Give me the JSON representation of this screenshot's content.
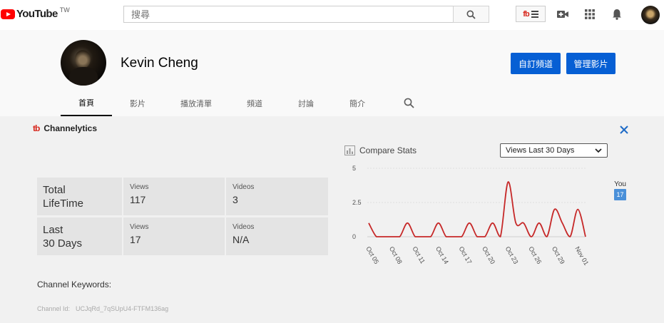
{
  "topbar": {
    "logo_text": "YouTube",
    "logo_region": "TW",
    "search_placeholder": "搜尋",
    "icons": [
      "search-icon",
      "tubebuddy-menu-icon",
      "create-video-icon",
      "apps-grid-icon",
      "notifications-bell-icon",
      "account-avatar"
    ]
  },
  "channel": {
    "name": "Kevin Cheng",
    "customize_button": "自訂頻道",
    "manage_button": "管理影片",
    "tabs": [
      {
        "label": "首頁",
        "active": true
      },
      {
        "label": "影片",
        "active": false
      },
      {
        "label": "播放清單",
        "active": false
      },
      {
        "label": "頻道",
        "active": false
      },
      {
        "label": "討論",
        "active": false
      },
      {
        "label": "簡介",
        "active": false
      }
    ]
  },
  "channelytics": {
    "logo": "tb",
    "title": "Channelytics",
    "stats": {
      "lifetime": {
        "label_line1": "Total",
        "label_line2": "LifeTime",
        "views_label": "Views",
        "views": "117",
        "videos_label": "Videos",
        "videos": "3"
      },
      "last30": {
        "label_line1": "Last",
        "label_line2": "30 Days",
        "views_label": "Views",
        "views": "17",
        "videos_label": "Videos",
        "videos": "N/A"
      }
    },
    "keywords_label": "Channel Keywords:",
    "channel_id_label": "Channel Id:",
    "channel_id": "UCJqRd_7qSUpU4-FTFM136ag",
    "compare_label": "Compare Stats",
    "compare_select": "Views Last 30 Days",
    "legend_label": "You",
    "legend_value": "17"
  },
  "colors": {
    "brand_red": "#ff0000",
    "button_blue": "#065fd4",
    "line_red": "#c62828",
    "legend_blue": "#4a90d9"
  },
  "chart_data": {
    "type": "line",
    "title": "",
    "xlabel": "",
    "ylabel": "",
    "ylim": [
      0,
      5
    ],
    "yticks": [
      "0",
      "2.5",
      "5"
    ],
    "x_tick_labels": [
      "Oct 05",
      "Oct 08",
      "Oct 11",
      "Oct 14",
      "Oct 17",
      "Oct 20",
      "Oct 23",
      "Oct 26",
      "Oct 29",
      "Nov 01"
    ],
    "x": [
      "Oct 05",
      "Oct 06",
      "Oct 07",
      "Oct 08",
      "Oct 09",
      "Oct 10",
      "Oct 11",
      "Oct 12",
      "Oct 13",
      "Oct 14",
      "Oct 15",
      "Oct 16",
      "Oct 17",
      "Oct 18",
      "Oct 19",
      "Oct 20",
      "Oct 21",
      "Oct 22",
      "Oct 23",
      "Oct 24",
      "Oct 25",
      "Oct 26",
      "Oct 27",
      "Oct 28",
      "Oct 29",
      "Oct 30",
      "Oct 31",
      "Nov 01",
      "Nov 02"
    ],
    "series": [
      {
        "name": "You",
        "values": [
          1,
          0,
          0,
          0,
          0,
          1,
          0,
          0,
          0,
          1,
          0,
          0,
          0,
          1,
          0,
          0,
          1,
          0,
          4,
          1,
          1,
          0,
          1,
          0,
          2,
          1,
          0,
          2,
          0
        ]
      }
    ],
    "grid": true,
    "legend": "right"
  }
}
